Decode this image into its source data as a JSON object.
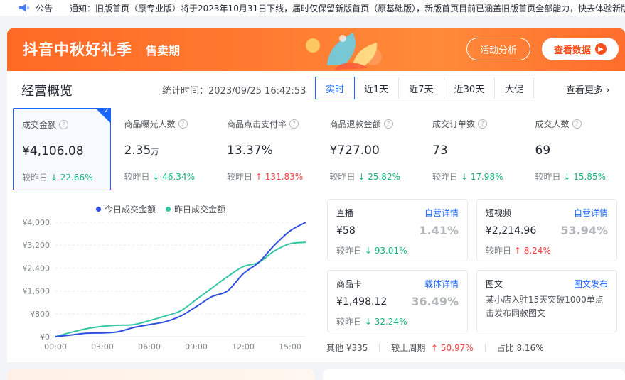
{
  "notice": {
    "tag": "公告",
    "message": "通知：旧版首页（原专业版）将于2023年10月31日下线，届时仅保留新版首页（原基础版），新版首页目前已涵盖旧版首页全部能力，快去体验新版"
  },
  "banner": {
    "title": "抖音中秋好礼季",
    "subtitle": "售卖期",
    "btn_analysis": "活动分析",
    "btn_view": "查看数据"
  },
  "overview": {
    "title": "经营概览",
    "stat_time": "统计时间：2023/09/25 16:42:53",
    "tabs": [
      "实时",
      "近1天",
      "近7天",
      "近30天",
      "大促"
    ],
    "more": "查看更多 ›"
  },
  "cards": [
    {
      "label": "成交金额",
      "value": "¥4,106.08",
      "unit": "",
      "cmp_label": "较昨日",
      "dir": "down",
      "cmp": "22.66%"
    },
    {
      "label": "商品曝光人数",
      "value": "2.35",
      "unit": "万",
      "cmp_label": "较昨日",
      "dir": "down",
      "cmp": "46.34%"
    },
    {
      "label": "商品点击支付率",
      "value": "13.37%",
      "unit": "",
      "cmp_label": "较昨日",
      "dir": "up",
      "cmp": "131.83%"
    },
    {
      "label": "商品退款金额",
      "value": "¥727.00",
      "unit": "",
      "cmp_label": "较昨日",
      "dir": "down",
      "cmp": "25.82%"
    },
    {
      "label": "成交订单数",
      "value": "73",
      "unit": "",
      "cmp_label": "较昨日",
      "dir": "down",
      "cmp": "17.98%"
    },
    {
      "label": "成交人数",
      "value": "69",
      "unit": "",
      "cmp_label": "较昨日",
      "dir": "down",
      "cmp": "15.85%"
    }
  ],
  "chart_data": {
    "type": "line",
    "x": [
      "00:00",
      "01:00",
      "02:00",
      "03:00",
      "04:00",
      "05:00",
      "06:00",
      "07:00",
      "08:00",
      "09:00",
      "10:00",
      "11:00",
      "12:00",
      "13:00",
      "14:00",
      "15:00",
      "16:00"
    ],
    "xticks": [
      "00:00",
      "03:00",
      "06:00",
      "09:00",
      "12:00",
      "15:00"
    ],
    "yticks": [
      "¥0",
      "¥800",
      "¥1,600",
      "¥2,400",
      "¥3,200",
      "¥4,000"
    ],
    "ylim": [
      0,
      4000
    ],
    "series": [
      {
        "name": "今日成交金额",
        "color": "#2e4fe0",
        "values": [
          0,
          60,
          120,
          130,
          170,
          320,
          420,
          520,
          720,
          1050,
          1400,
          1600,
          2200,
          2600,
          3200,
          3700,
          4000
        ]
      },
      {
        "name": "昨日成交金额",
        "color": "#33c7a5",
        "values": [
          0,
          150,
          280,
          360,
          400,
          420,
          560,
          720,
          900,
          1300,
          1700,
          2100,
          2450,
          2600,
          3000,
          3250,
          3300
        ]
      }
    ],
    "legend": "top"
  },
  "channels": [
    {
      "name": "直播",
      "link": "自营详情",
      "value": "¥58",
      "pct": "1.41%",
      "cmp_label": "较昨日",
      "dir": "down",
      "cmp": "93.01%"
    },
    {
      "name": "短视频",
      "link": "自营详情",
      "value": "¥2,214.96",
      "pct": "53.94%",
      "cmp_label": "较昨日",
      "dir": "up",
      "cmp": "8.24%"
    },
    {
      "name": "商品卡",
      "link": "载体详情",
      "value": "¥1,498.12",
      "pct": "36.49%",
      "cmp_label": "较昨日",
      "dir": "down",
      "cmp": "32.24%"
    },
    {
      "name": "图文",
      "link": "图文发布",
      "desc": "某小店入驻15天突破1000单点击发布同款图文"
    }
  ],
  "other": {
    "label": "其他 ¥335",
    "week_label": "较上周期",
    "week_dir": "up",
    "week_cmp": "50.97%",
    "ratio": "占比 8.16%"
  }
}
